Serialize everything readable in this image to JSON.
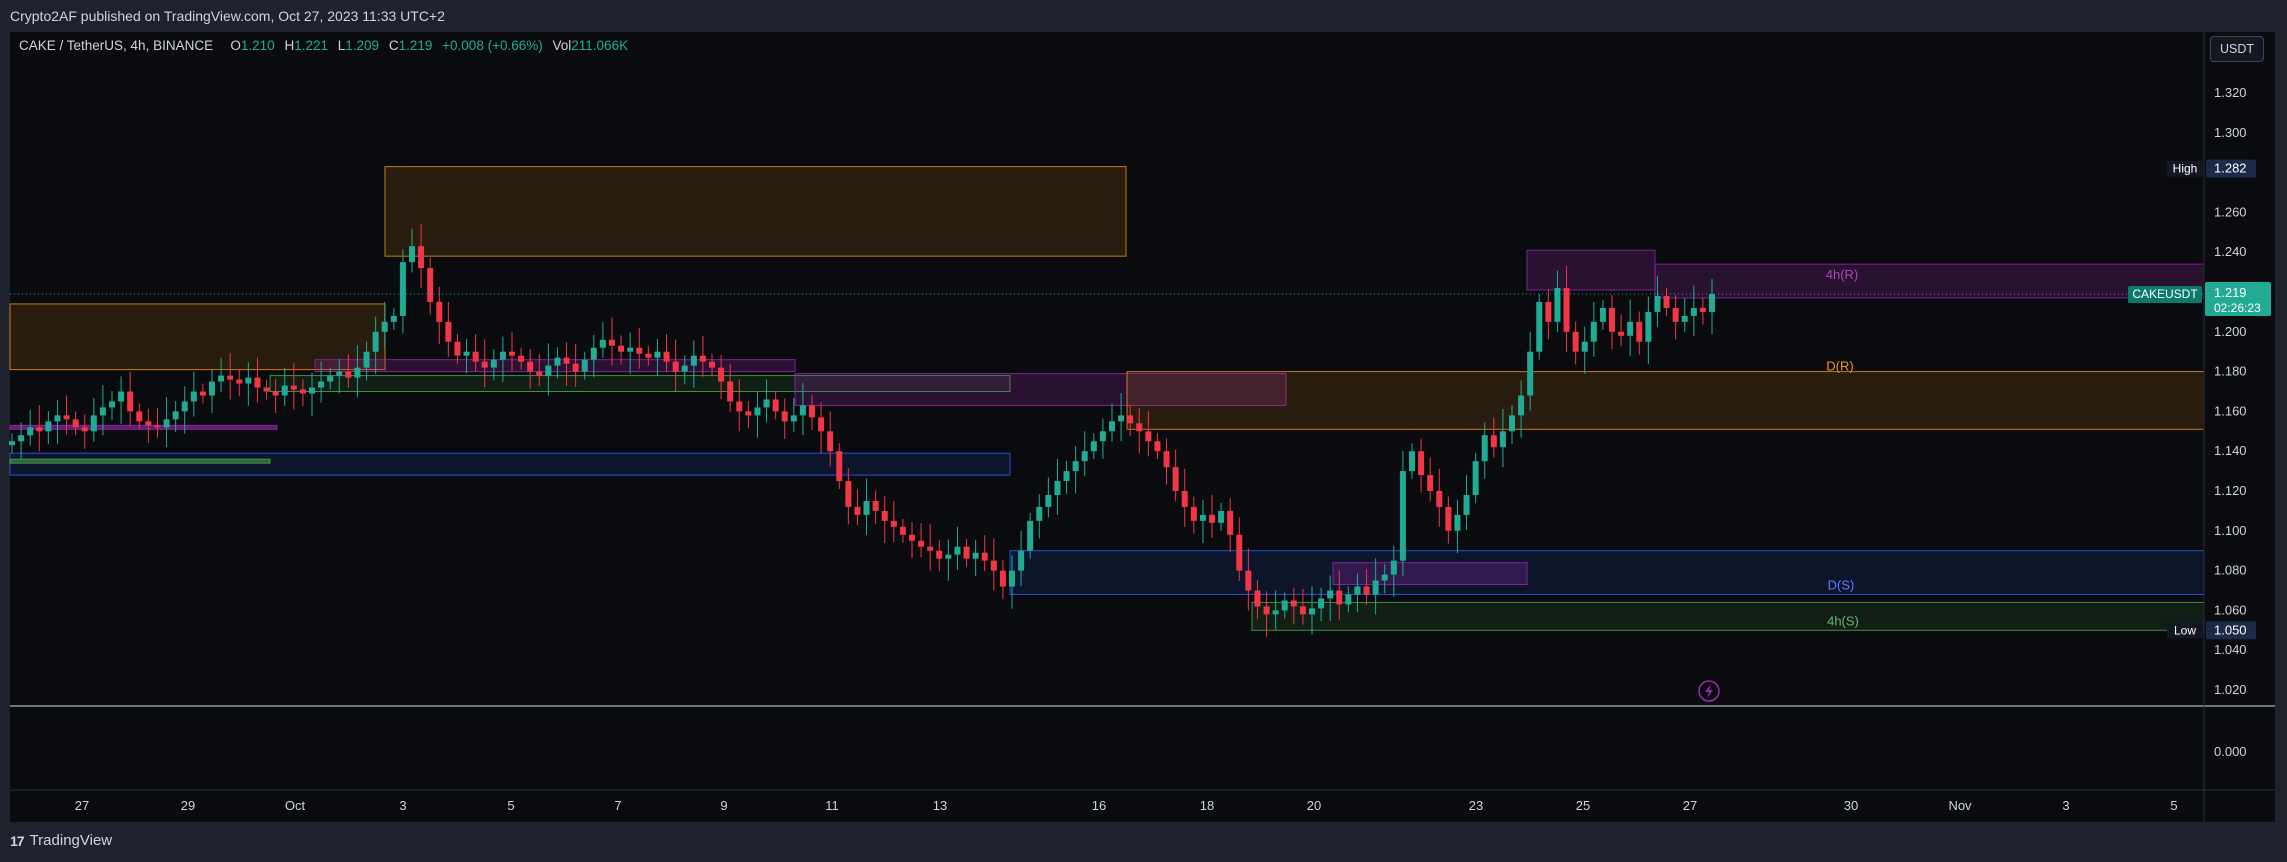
{
  "header": {
    "published_text": "Crypto2AF published on TradingView.com, Oct 27, 2023 11:33 UTC+2"
  },
  "legend": {
    "symbol": "CAKE / TetherUS, 4h, BINANCE",
    "o_label": "O",
    "o_value": "1.210",
    "h_label": "H",
    "h_value": "1.221",
    "l_label": "L",
    "l_value": "1.209",
    "c_label": "C",
    "c_value": "1.219",
    "change": "+0.008 (+0.66%)",
    "vol_label": "Vol",
    "vol_value": "211.066K"
  },
  "price_scale": {
    "currency": "USDT",
    "ticks": [
      "1.320",
      "1.300",
      "1.280",
      "1.260",
      "1.240",
      "1.220",
      "1.200",
      "1.180",
      "1.160",
      "1.140",
      "1.120",
      "1.100",
      "1.080",
      "1.060",
      "1.040",
      "1.020"
    ],
    "high_label": "High",
    "high_value": "1.282",
    "low_label": "Low",
    "low_value": "1.050",
    "current_symbol": "CAKEUSDT",
    "current_price": "1.219",
    "countdown": "02:26:23",
    "indicator_tick": "0.000"
  },
  "time_axis": {
    "labels": [
      "27",
      "29",
      "Oct",
      "3",
      "5",
      "7",
      "9",
      "11",
      "13",
      "16",
      "18",
      "20",
      "23",
      "25",
      "27",
      "30",
      "Nov",
      "3",
      "5"
    ]
  },
  "zone_labels": {
    "r4h": "4h(R)",
    "dr": "D(R)",
    "ds": "D(S)",
    "s4h": "4h(S)"
  },
  "footer": {
    "brand_mark": "17",
    "brand_text": "TradingView"
  },
  "colors": {
    "up": "#22ab94",
    "down": "#f23645",
    "background": "#0a0b0e",
    "orange_zone": "#f7931a",
    "purple_zone": "#9c27b0",
    "blue_zone": "#2962ff",
    "green_zone": "#4caf50"
  },
  "chart_data": {
    "type": "candlestick",
    "symbol": "CAKE / TetherUS",
    "interval": "4h",
    "exchange": "BINANCE",
    "ylim": [
      1.015,
      1.335
    ],
    "x_labels": [
      "27",
      "29",
      "Oct",
      "3",
      "5",
      "7",
      "9",
      "11",
      "13",
      "16",
      "18",
      "20",
      "23",
      "25",
      "27",
      "30",
      "Nov",
      "3",
      "5"
    ],
    "last": {
      "open": 1.21,
      "high": 1.221,
      "low": 1.209,
      "close": 1.219
    },
    "high_marker": 1.282,
    "low_marker": 1.05,
    "indicator_pane_value": 0.0,
    "zones": [
      {
        "label": "4h(R)",
        "color": "purple",
        "from": 1.217,
        "to": 1.234
      },
      {
        "label": "D(R)",
        "color": "orange",
        "from": 1.15,
        "to": 1.18
      },
      {
        "label": "D(S)",
        "color": "blue",
        "from": 1.068,
        "to": 1.09
      },
      {
        "label": "4h(S)",
        "color": "green",
        "from": 1.05,
        "to": 1.064
      }
    ],
    "closes": [
      1.145,
      1.148,
      1.152,
      1.15,
      1.155,
      1.158,
      1.156,
      1.152,
      1.15,
      1.158,
      1.162,
      1.165,
      1.17,
      1.16,
      1.155,
      1.153,
      1.152,
      1.156,
      1.16,
      1.165,
      1.17,
      1.168,
      1.175,
      1.178,
      1.176,
      1.174,
      1.177,
      1.172,
      1.17,
      1.168,
      1.173,
      1.171,
      1.169,
      1.172,
      1.175,
      1.178,
      1.18,
      1.177,
      1.182,
      1.19,
      1.2,
      1.205,
      1.208,
      1.235,
      1.243,
      1.232,
      1.215,
      1.205,
      1.195,
      1.188,
      1.19,
      1.185,
      1.182,
      1.186,
      1.19,
      1.188,
      1.185,
      1.18,
      1.178,
      1.183,
      1.187,
      1.184,
      1.18,
      1.186,
      1.192,
      1.196,
      1.193,
      1.19,
      1.192,
      1.189,
      1.187,
      1.19,
      1.185,
      1.18,
      1.183,
      1.188,
      1.185,
      1.182,
      1.175,
      1.165,
      1.16,
      1.158,
      1.162,
      1.166,
      1.16,
      1.155,
      1.158,
      1.163,
      1.157,
      1.15,
      1.14,
      1.125,
      1.112,
      1.108,
      1.115,
      1.11,
      1.105,
      1.102,
      1.098,
      1.095,
      1.092,
      1.09,
      1.086,
      1.088,
      1.092,
      1.086,
      1.089,
      1.085,
      1.08,
      1.072,
      1.08,
      1.09,
      1.105,
      1.112,
      1.118,
      1.125,
      1.13,
      1.135,
      1.14,
      1.145,
      1.15,
      1.155,
      1.158,
      1.154,
      1.15,
      1.145,
      1.14,
      1.132,
      1.12,
      1.112,
      1.105,
      1.108,
      1.104,
      1.11,
      1.098,
      1.08,
      1.07,
      1.062,
      1.058,
      1.06,
      1.065,
      1.062,
      1.058,
      1.061,
      1.066,
      1.07,
      1.063,
      1.068,
      1.072,
      1.068,
      1.075,
      1.078,
      1.085,
      1.13,
      1.14,
      1.128,
      1.12,
      1.112,
      1.1,
      1.108,
      1.118,
      1.135,
      1.148,
      1.142,
      1.15,
      1.158,
      1.168,
      1.19,
      1.215,
      1.205,
      1.222,
      1.2,
      1.19,
      1.195,
      1.205,
      1.212,
      1.2,
      1.198,
      1.205,
      1.195,
      1.21,
      1.218,
      1.212,
      1.205,
      1.208,
      1.212,
      1.21,
      1.219
    ]
  }
}
